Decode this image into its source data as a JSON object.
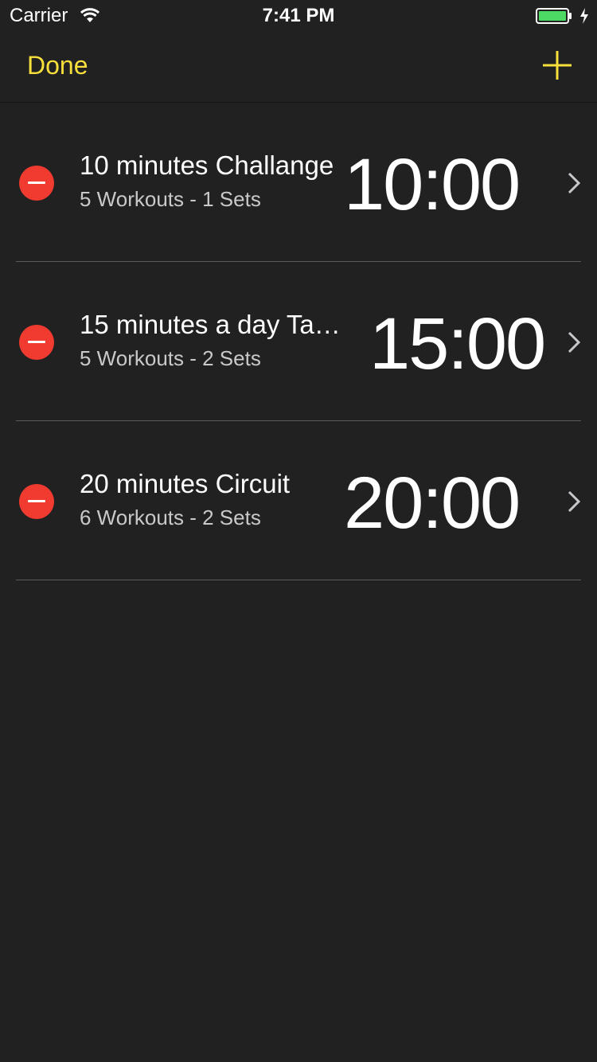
{
  "status_bar": {
    "carrier": "Carrier",
    "time": "7:41 PM",
    "wifi_icon": "wifi-icon",
    "battery_icon": "battery-icon",
    "battery_level": 1.0,
    "battery_color": "#4cd964",
    "charging_icon": "charging-bolt-icon"
  },
  "nav": {
    "done_label": "Done",
    "add_icon": "plus-icon",
    "accent_color": "#f7df3c"
  },
  "workouts": [
    {
      "title": "10 minutes Challange",
      "subtitle": "5 Workouts - 1 Sets",
      "time": "10:00"
    },
    {
      "title": "15 minutes a day Ta…",
      "subtitle": "5 Workouts - 2 Sets",
      "time": "15:00"
    },
    {
      "title": "20 minutes Circuit",
      "subtitle": "6 Workouts - 2 Sets",
      "time": "20:00"
    }
  ],
  "icons": {
    "delete": "minus-circle-icon",
    "disclosure": "chevron-right-icon"
  },
  "colors": {
    "background": "#212121",
    "delete": "#f23b30",
    "divider": "#5a5a5a"
  }
}
